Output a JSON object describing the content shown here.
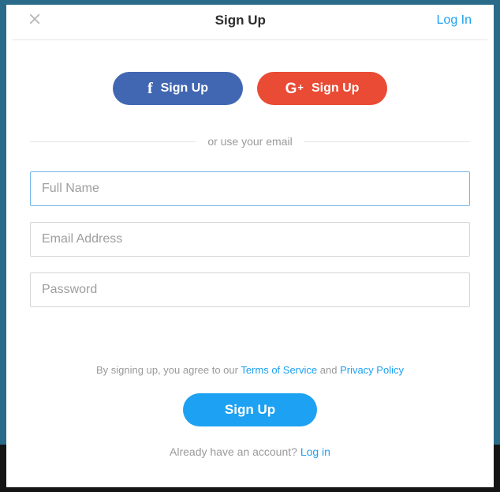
{
  "header": {
    "title": "Sign Up",
    "login_link": "Log In"
  },
  "social": {
    "facebook_label": "Sign Up",
    "google_label": "Sign Up"
  },
  "divider": {
    "text": "or use your email"
  },
  "fields": {
    "full_name_placeholder": "Full Name",
    "email_placeholder": "Email Address",
    "password_placeholder": "Password"
  },
  "legal": {
    "prefix": "By signing up, you agree to our ",
    "terms_label": "Terms of Service",
    "middle": " and ",
    "privacy_label": "Privacy Policy"
  },
  "submit": {
    "label": "Sign Up"
  },
  "already": {
    "prefix": "Already have an account? ",
    "login_label": "Log in"
  }
}
